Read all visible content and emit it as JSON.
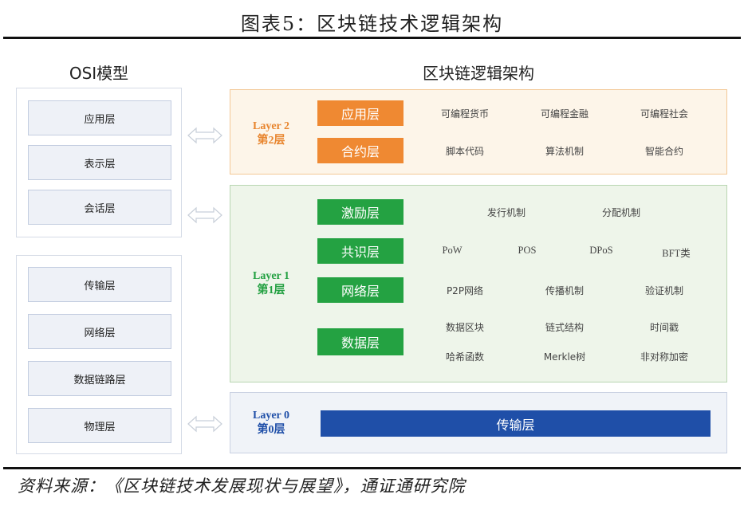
{
  "figure_title": "图表5：区块链技术逻辑架构",
  "osi": {
    "heading": "OSI模型",
    "upper": [
      "应用层",
      "表示层",
      "会话层"
    ],
    "lower": [
      "传输层",
      "网络层",
      "数据链路层",
      "物理层"
    ]
  },
  "arch": {
    "heading": "区块链逻辑架构",
    "layer2": {
      "label_en": "Layer 2",
      "label_cn": "第2层",
      "rows": [
        {
          "tag": "应用层",
          "items": [
            "可编程货币",
            "可编程金融",
            "可编程社会"
          ]
        },
        {
          "tag": "合约层",
          "items": [
            "脚本代码",
            "算法机制",
            "智能合约"
          ]
        }
      ]
    },
    "layer1": {
      "label_en": "Layer 1",
      "label_cn": "第1层",
      "incentive": {
        "tag": "激励层",
        "items": [
          "发行机制",
          "分配机制"
        ]
      },
      "consensus": {
        "tag": "共识层",
        "items": [
          "PoW",
          "POS",
          "DPoS",
          "BFT类"
        ]
      },
      "network": {
        "tag": "网络层",
        "items": [
          "P2P网络",
          "传播机制",
          "验证机制"
        ]
      },
      "data": {
        "tag": "数据层",
        "items_row1": [
          "数据区块",
          "链式结构",
          "时间戳"
        ],
        "items_row2": [
          "哈希函数",
          "Merkle树",
          "非对称加密"
        ]
      }
    },
    "layer0": {
      "label_en": "Layer 0",
      "label_cn": "第0层",
      "bar": "传输层"
    }
  },
  "source": "资料来源：《区块链技术发展现状与展望》，通证通研究院",
  "colors": {
    "orange": "#ef8932",
    "green": "#24a242",
    "blue": "#1f4fa8",
    "layer2_text": "#e8852e",
    "layer1_text": "#22a041",
    "layer0_text": "#1f4fa8"
  },
  "icons": {
    "connector": "double-arrow-icon"
  }
}
